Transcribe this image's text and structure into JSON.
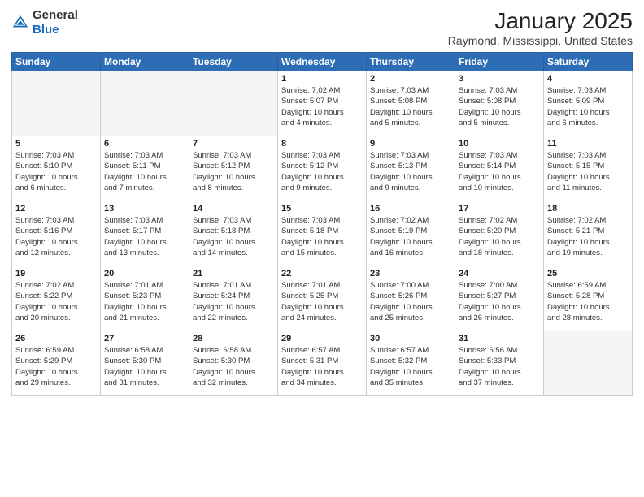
{
  "header": {
    "logo_line1": "General",
    "logo_line2": "Blue",
    "title": "January 2025",
    "subtitle": "Raymond, Mississippi, United States"
  },
  "days_of_week": [
    "Sunday",
    "Monday",
    "Tuesday",
    "Wednesday",
    "Thursday",
    "Friday",
    "Saturday"
  ],
  "weeks": [
    [
      {
        "day": "",
        "info": ""
      },
      {
        "day": "",
        "info": ""
      },
      {
        "day": "",
        "info": ""
      },
      {
        "day": "1",
        "info": "Sunrise: 7:02 AM\nSunset: 5:07 PM\nDaylight: 10 hours\nand 4 minutes."
      },
      {
        "day": "2",
        "info": "Sunrise: 7:03 AM\nSunset: 5:08 PM\nDaylight: 10 hours\nand 5 minutes."
      },
      {
        "day": "3",
        "info": "Sunrise: 7:03 AM\nSunset: 5:08 PM\nDaylight: 10 hours\nand 5 minutes."
      },
      {
        "day": "4",
        "info": "Sunrise: 7:03 AM\nSunset: 5:09 PM\nDaylight: 10 hours\nand 6 minutes."
      }
    ],
    [
      {
        "day": "5",
        "info": "Sunrise: 7:03 AM\nSunset: 5:10 PM\nDaylight: 10 hours\nand 6 minutes."
      },
      {
        "day": "6",
        "info": "Sunrise: 7:03 AM\nSunset: 5:11 PM\nDaylight: 10 hours\nand 7 minutes."
      },
      {
        "day": "7",
        "info": "Sunrise: 7:03 AM\nSunset: 5:12 PM\nDaylight: 10 hours\nand 8 minutes."
      },
      {
        "day": "8",
        "info": "Sunrise: 7:03 AM\nSunset: 5:12 PM\nDaylight: 10 hours\nand 9 minutes."
      },
      {
        "day": "9",
        "info": "Sunrise: 7:03 AM\nSunset: 5:13 PM\nDaylight: 10 hours\nand 9 minutes."
      },
      {
        "day": "10",
        "info": "Sunrise: 7:03 AM\nSunset: 5:14 PM\nDaylight: 10 hours\nand 10 minutes."
      },
      {
        "day": "11",
        "info": "Sunrise: 7:03 AM\nSunset: 5:15 PM\nDaylight: 10 hours\nand 11 minutes."
      }
    ],
    [
      {
        "day": "12",
        "info": "Sunrise: 7:03 AM\nSunset: 5:16 PM\nDaylight: 10 hours\nand 12 minutes."
      },
      {
        "day": "13",
        "info": "Sunrise: 7:03 AM\nSunset: 5:17 PM\nDaylight: 10 hours\nand 13 minutes."
      },
      {
        "day": "14",
        "info": "Sunrise: 7:03 AM\nSunset: 5:18 PM\nDaylight: 10 hours\nand 14 minutes."
      },
      {
        "day": "15",
        "info": "Sunrise: 7:03 AM\nSunset: 5:18 PM\nDaylight: 10 hours\nand 15 minutes."
      },
      {
        "day": "16",
        "info": "Sunrise: 7:02 AM\nSunset: 5:19 PM\nDaylight: 10 hours\nand 16 minutes."
      },
      {
        "day": "17",
        "info": "Sunrise: 7:02 AM\nSunset: 5:20 PM\nDaylight: 10 hours\nand 18 minutes."
      },
      {
        "day": "18",
        "info": "Sunrise: 7:02 AM\nSunset: 5:21 PM\nDaylight: 10 hours\nand 19 minutes."
      }
    ],
    [
      {
        "day": "19",
        "info": "Sunrise: 7:02 AM\nSunset: 5:22 PM\nDaylight: 10 hours\nand 20 minutes."
      },
      {
        "day": "20",
        "info": "Sunrise: 7:01 AM\nSunset: 5:23 PM\nDaylight: 10 hours\nand 21 minutes."
      },
      {
        "day": "21",
        "info": "Sunrise: 7:01 AM\nSunset: 5:24 PM\nDaylight: 10 hours\nand 22 minutes."
      },
      {
        "day": "22",
        "info": "Sunrise: 7:01 AM\nSunset: 5:25 PM\nDaylight: 10 hours\nand 24 minutes."
      },
      {
        "day": "23",
        "info": "Sunrise: 7:00 AM\nSunset: 5:26 PM\nDaylight: 10 hours\nand 25 minutes."
      },
      {
        "day": "24",
        "info": "Sunrise: 7:00 AM\nSunset: 5:27 PM\nDaylight: 10 hours\nand 26 minutes."
      },
      {
        "day": "25",
        "info": "Sunrise: 6:59 AM\nSunset: 5:28 PM\nDaylight: 10 hours\nand 28 minutes."
      }
    ],
    [
      {
        "day": "26",
        "info": "Sunrise: 6:59 AM\nSunset: 5:29 PM\nDaylight: 10 hours\nand 29 minutes."
      },
      {
        "day": "27",
        "info": "Sunrise: 6:58 AM\nSunset: 5:30 PM\nDaylight: 10 hours\nand 31 minutes."
      },
      {
        "day": "28",
        "info": "Sunrise: 6:58 AM\nSunset: 5:30 PM\nDaylight: 10 hours\nand 32 minutes."
      },
      {
        "day": "29",
        "info": "Sunrise: 6:57 AM\nSunset: 5:31 PM\nDaylight: 10 hours\nand 34 minutes."
      },
      {
        "day": "30",
        "info": "Sunrise: 6:57 AM\nSunset: 5:32 PM\nDaylight: 10 hours\nand 35 minutes."
      },
      {
        "day": "31",
        "info": "Sunrise: 6:56 AM\nSunset: 5:33 PM\nDaylight: 10 hours\nand 37 minutes."
      },
      {
        "day": "",
        "info": ""
      }
    ]
  ]
}
